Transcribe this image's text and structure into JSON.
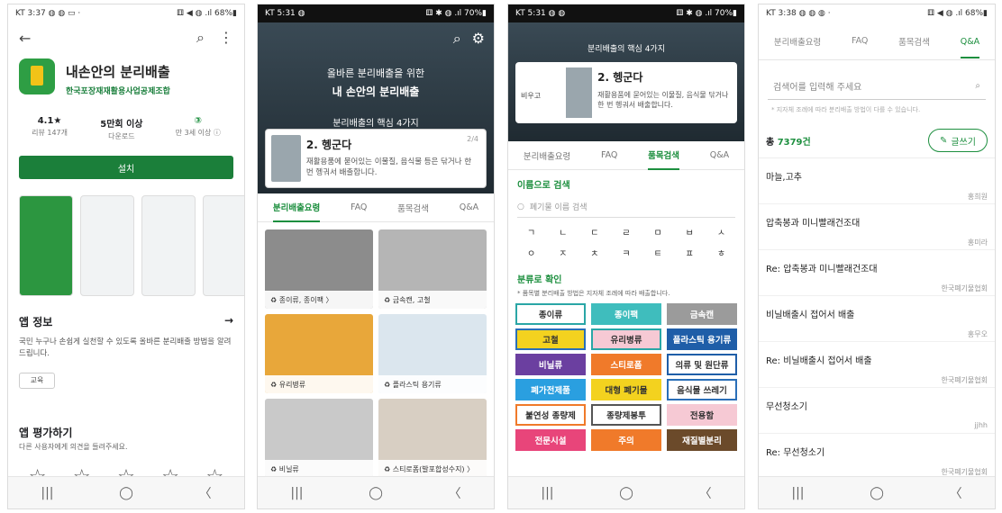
{
  "colors": {
    "accent": "#1d8f3f",
    "install": "#1b7f3a"
  },
  "screen1": {
    "status_left": "KT 3:37 ◍ ◍ ▭ ·",
    "status_right": "⚅ ◀ ◍ .ıl 68%▮",
    "app_title": "내손안의 분리배출",
    "developer": "한국포장재재활용사업공제조합",
    "stats": [
      {
        "value": "4.1★",
        "label": "리뷰 147개"
      },
      {
        "value": "5만회 이상",
        "label": "다운로드"
      },
      {
        "value": "③",
        "label": "만 3세 이상 ⓘ"
      }
    ],
    "install_label": "설치",
    "about_title": "앱 정보",
    "about_desc": "국민 누구나 손쉽게 실천할 수 있도록 올바른 분리배출 방법을 알려드립니다.",
    "chip": "교육",
    "rate_title": "앱 평가하기",
    "rate_sub": "다른 사용자에게 의견을 들려주세요.",
    "nav": [
      "|||",
      "◯",
      "〈"
    ]
  },
  "screen2": {
    "status_left": "KT 5:31 ◍",
    "status_right": "⚅ ✱ ◍ .ıl 70%▮",
    "hero_line1": "올바른 분리배출을 위한",
    "hero_line2": "내 손안의 분리배출",
    "hero_line3": "분리배출의 핵심 4가지",
    "card_title": "2. 헹군다",
    "card_desc": "재활용품에 묻어있는 이물질, 음식물 등은 닦거나 한 번 헹궈서 배출합니다.",
    "card_page": "2/4",
    "tabs": [
      "분리배출요령",
      "FAQ",
      "품목검색",
      "Q&A"
    ],
    "tiles": [
      "♻ 종이류, 종이팩 〉",
      "♻ 금속캔, 고철",
      "♻ 유리병류",
      "♻ 플라스틱 용기류",
      "♻ 비닐류",
      "♻ 스티로폼(발포합성수지) 〉"
    ],
    "nav": [
      "|||",
      "◯",
      "〈"
    ]
  },
  "screen3": {
    "status_left": "KT 5:31 ◍ ◍",
    "status_right": "⚅ ✱ ◍ .ıl 70%▮",
    "hero_caption": "분리배출의 핵심 4가지",
    "card_side": "비우고",
    "card_title": "2. 헹군다",
    "card_desc": "재활용품에 묻어있는 이물질, 음식물 닦거나 한 번 헹궈서 배출합니다.",
    "tabs": [
      "분리배출요령",
      "FAQ",
      "품목검색",
      "Q&A"
    ],
    "search_title": "이름으로 검색",
    "search_placeholder": "폐기물 이름 검색",
    "consonants": [
      "ㄱ",
      "ㄴ",
      "ㄷ",
      "ㄹ",
      "ㅁ",
      "ㅂ",
      "ㅅ",
      "ㅇ",
      "ㅈ",
      "ㅊ",
      "ㅋ",
      "ㅌ",
      "ㅍ",
      "ㅎ"
    ],
    "cat_title": "분류로 확인",
    "cat_note": "* 품목별 분리배출 방법은 지자체 조례에 따라 배출합니다.",
    "categories": [
      {
        "label": "종이류",
        "bg": "#ffffff",
        "fg": "#333333",
        "bd": "#2aa6a6"
      },
      {
        "label": "종이팩",
        "bg": "#3fbdbd",
        "fg": "#ffffff",
        "bd": "#3fbdbd"
      },
      {
        "label": "금속캔",
        "bg": "#9b9b9b",
        "fg": "#ffffff",
        "bd": "#9b9b9b"
      },
      {
        "label": "고철",
        "bg": "#f3d21f",
        "fg": "#333333",
        "bd": "#2a6fb8"
      },
      {
        "label": "유리병류",
        "bg": "#f6c9d4",
        "fg": "#333333",
        "bd": "#2aa6a6"
      },
      {
        "label": "플라스틱 용기류",
        "bg": "#1f5ea8",
        "fg": "#ffffff",
        "bd": "#1f5ea8"
      },
      {
        "label": "비닐류",
        "bg": "#6b3fa0",
        "fg": "#ffffff",
        "bd": "#6b3fa0"
      },
      {
        "label": "스티로폼",
        "bg": "#f07a2a",
        "fg": "#ffffff",
        "bd": "#f07a2a"
      },
      {
        "label": "의류 및 원단류",
        "bg": "#ffffff",
        "fg": "#333333",
        "bd": "#1f5ea8"
      },
      {
        "label": "폐가전제품",
        "bg": "#2a9fe0",
        "fg": "#ffffff",
        "bd": "#2a9fe0"
      },
      {
        "label": "대형 폐기물",
        "bg": "#f3d21f",
        "fg": "#333333",
        "bd": "#f3d21f"
      },
      {
        "label": "음식물 쓰레기",
        "bg": "#ffffff",
        "fg": "#333333",
        "bd": "#2a6fb8"
      },
      {
        "label": "불연성 종량제",
        "bg": "#ffffff",
        "fg": "#333333",
        "bd": "#f07a2a"
      },
      {
        "label": "종량제봉투",
        "bg": "#ffffff",
        "fg": "#333333",
        "bd": "#555555"
      },
      {
        "label": "전용함",
        "bg": "#f6c9d4",
        "fg": "#333333",
        "bd": "#f6c9d4"
      },
      {
        "label": "전문시설",
        "bg": "#e8457a",
        "fg": "#ffffff",
        "bd": "#e8457a"
      },
      {
        "label": "주의",
        "bg": "#f07a2a",
        "fg": "#ffffff",
        "bd": "#f07a2a"
      },
      {
        "label": "재질별분리",
        "bg": "#6b4a2a",
        "fg": "#ffffff",
        "bd": "#6b4a2a"
      }
    ],
    "nav": [
      "|||",
      "◯",
      "〈"
    ]
  },
  "screen4": {
    "status_left": "KT 3:38 ◍ ◍ ◍ ·",
    "status_right": "⚅ ◀ ◍ .ıl 68%▮",
    "tabs": [
      "분리배출요령",
      "FAQ",
      "품목검색",
      "Q&A"
    ],
    "search_placeholder": "검색어를 입력해 주세요",
    "hint": "* 지자체 조례에 따라 분리배출 방법이 다를 수 있습니다.",
    "count_prefix": "총 ",
    "count": "7379건",
    "write_label": "글쓰기",
    "posts": [
      {
        "title": "마늘,고추",
        "author": "홍희원"
      },
      {
        "title": "압축봉과 미니빨래건조대",
        "author": "홍미라"
      },
      {
        "title": "Re: 압축봉과 미니빨래건조대",
        "author": "한국폐기물협회"
      },
      {
        "title": "비닐배출시 접어서 배출",
        "author": "홍무오"
      },
      {
        "title": "Re: 비닐배출시 접어서 배출",
        "author": "한국폐기물협회"
      },
      {
        "title": "무선청소기",
        "author": "jjhh"
      },
      {
        "title": "Re: 무선청소기",
        "author": "한국폐기물협회"
      }
    ],
    "nav": [
      "|||",
      "◯",
      "〈"
    ]
  }
}
